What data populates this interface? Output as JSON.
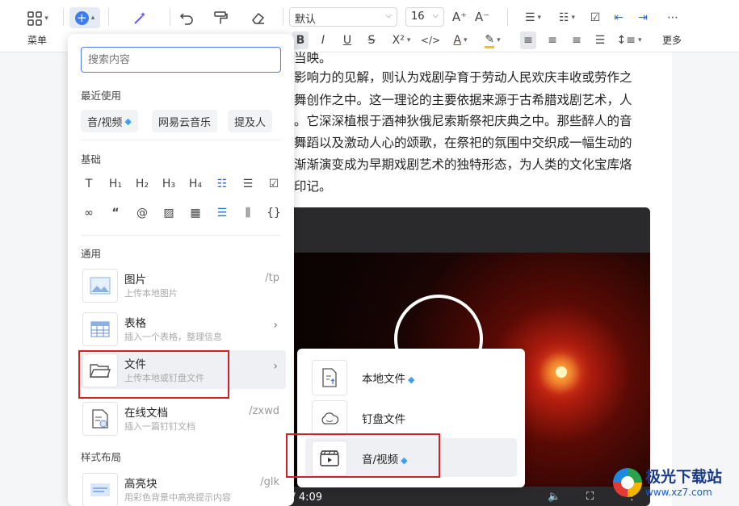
{
  "toolbar": {
    "menu_label": "菜单",
    "font_name": "默认",
    "font_size": "16",
    "more_label": "更多"
  },
  "document": {
    "lines": [
      "当映。",
      "影响力的见解，则认为戏剧孕育于劳动人民欢庆丰收或劳作之",
      "舞创作之中。这一理论的主要依据来源于古希腊戏剧艺术，人",
      "。它深深植根于酒神狄俄尼索斯祭祀庆典之中。那些醉人的音",
      "舞蹈以及激动人心的颂歌，在祭祀的氛围中交织成一幅生动的",
      "渐渐演变成为早期戏剧艺术的独特形态，为人类的文化宝库烙",
      "印记。"
    ]
  },
  "video": {
    "time": "0:02 / 4:09"
  },
  "insert_panel": {
    "search_placeholder": "搜索内容",
    "recent_title": "最近使用",
    "recent": [
      "音/视频",
      "网易云音乐",
      "提及人"
    ],
    "basic_title": "基础",
    "common_title": "通用",
    "items": [
      {
        "title": "图片",
        "desc": "上传本地图片",
        "shortcut": "/tp"
      },
      {
        "title": "表格",
        "desc": "插入一个表格，整理信息",
        "shortcut": ""
      },
      {
        "title": "文件",
        "desc": "上传本地或钉盘文件",
        "shortcut": ""
      },
      {
        "title": "在线文档",
        "desc": "插入一篇钉钉文档",
        "shortcut": "/zxwd"
      }
    ],
    "layout_title": "样式布局",
    "layout_items": [
      {
        "title": "高亮块",
        "desc": "用彩色背景中高亮提示内容",
        "shortcut": "/glk"
      }
    ]
  },
  "file_submenu": {
    "items": [
      "本地文件",
      "钉盘文件",
      "音/视频"
    ]
  },
  "watermark": {
    "name": "极光下载站",
    "url": "www.xz7.com"
  },
  "colors": {
    "accent": "#4a7de8",
    "highlight_box": "#d32020",
    "gem": "#3aa0ff"
  }
}
